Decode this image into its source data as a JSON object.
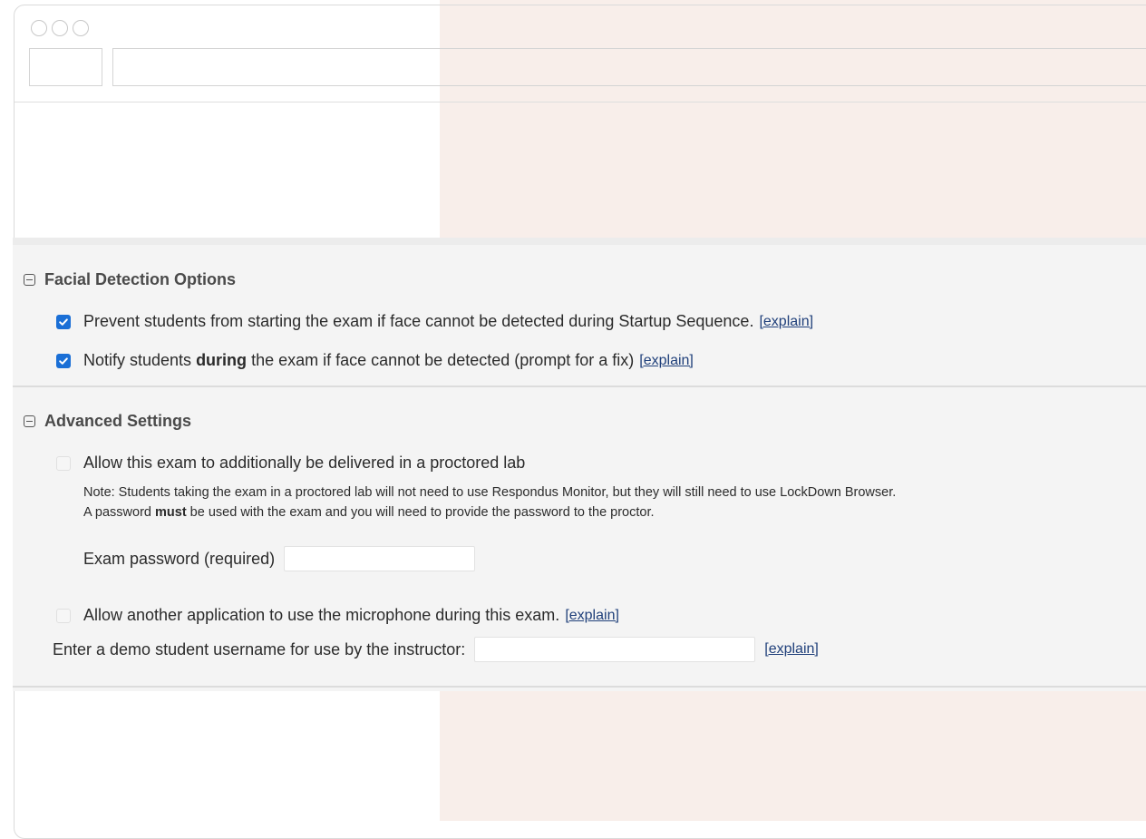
{
  "facial_detection": {
    "title": "Facial Detection Options",
    "option1": {
      "checked": true,
      "label": "Prevent students from starting the exam if face cannot be detected during Startup Sequence.",
      "explain": "[explain]"
    },
    "option2": {
      "checked": true,
      "label_pre": "Notify students ",
      "label_bold": "during",
      "label_post": " the exam if face cannot be detected (prompt for a fix)",
      "explain": "[explain]"
    }
  },
  "advanced": {
    "title": "Advanced Settings",
    "proctored": {
      "checked": false,
      "label": "Allow this exam to additionally be delivered in a proctored lab",
      "note_line1": "Note: Students taking the exam in a proctored lab will not need to use Respondus Monitor, but they will still need to use LockDown Browser.",
      "note_line2_pre": "A password ",
      "note_line2_bold": "must",
      "note_line2_post": " be used with the exam and you will need to provide the password to the proctor.",
      "password_label": "Exam password (required)",
      "password_value": ""
    },
    "microphone": {
      "checked": false,
      "label": "Allow another application to use the microphone during this exam.",
      "explain": "[explain]"
    },
    "demo_user": {
      "label": "Enter a demo student username for use by the instructor:",
      "value": "",
      "explain": "[explain]"
    }
  }
}
